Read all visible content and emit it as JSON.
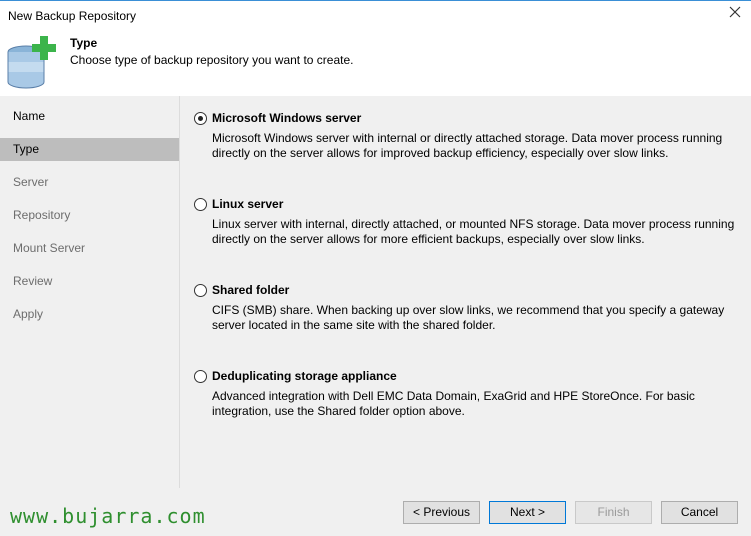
{
  "window": {
    "title": "New Backup Repository"
  },
  "header": {
    "title": "Type",
    "subtitle": "Choose type of backup repository you want to create."
  },
  "sidebar": {
    "items": [
      {
        "label": "Name",
        "state": "done"
      },
      {
        "label": "Type",
        "state": "active"
      },
      {
        "label": "Server",
        "state": "pending"
      },
      {
        "label": "Repository",
        "state": "pending"
      },
      {
        "label": "Mount Server",
        "state": "pending"
      },
      {
        "label": "Review",
        "state": "pending"
      },
      {
        "label": "Apply",
        "state": "pending"
      }
    ]
  },
  "options": [
    {
      "title": "Microsoft Windows server",
      "description": "Microsoft Windows server with internal or directly attached storage. Data mover process running directly on the server allows for improved backup efficiency, especially over slow links.",
      "checked": true
    },
    {
      "title": "Linux server",
      "description": "Linux server with internal, directly attached, or mounted NFS storage. Data mover process running directly on the server allows for more efficient backups, especially over slow links.",
      "checked": false
    },
    {
      "title": "Shared folder",
      "description": "CIFS (SMB) share. When backing up over slow links, we recommend that you specify a gateway server located in the same site with the shared folder.",
      "checked": false
    },
    {
      "title": "Deduplicating storage appliance",
      "description": "Advanced integration with Dell EMC Data Domain, ExaGrid and HPE StoreOnce. For basic integration, use the Shared folder option above.",
      "checked": false
    }
  ],
  "footer": {
    "watermark": "www.bujarra.com",
    "previous_label": "< Previous",
    "next_label": "Next >",
    "finish_label": "Finish",
    "cancel_label": "Cancel"
  },
  "colors": {
    "accent": "#0078d7",
    "watermark": "#2f8f2f",
    "sidebar_active": "#bdbdbd",
    "panel_bg": "#f0f0f0"
  },
  "icons": {
    "header": "database-add-icon",
    "close": "close-icon"
  }
}
